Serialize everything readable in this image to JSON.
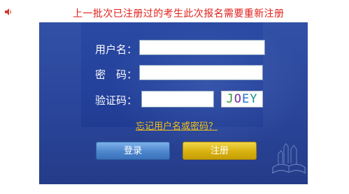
{
  "notice": "上一批次已注册过的考生此次报名需要重新注册",
  "icons": {
    "sound": "speaker-icon",
    "book": "book-icon"
  },
  "form": {
    "username_label": "用户名：",
    "password_label": "密　码：",
    "captcha_label": "验证码：",
    "username_value": "",
    "password_value": "",
    "captcha_value": "",
    "captcha_text": [
      "J",
      "O",
      "E",
      "Y"
    ],
    "captcha_colors": [
      "#2a9b2a",
      "#7a2aa8",
      "#1f6fd0",
      "#1a8f8f"
    ],
    "forgot_link": "忘记用户名或密码？"
  },
  "buttons": {
    "login": "登录",
    "register": "注册"
  },
  "colors": {
    "notice": "#e0201a",
    "panel": "#23409a",
    "link": "#f2c21a",
    "login_button": "#4e87cc",
    "register_button": "#d8b10f"
  }
}
